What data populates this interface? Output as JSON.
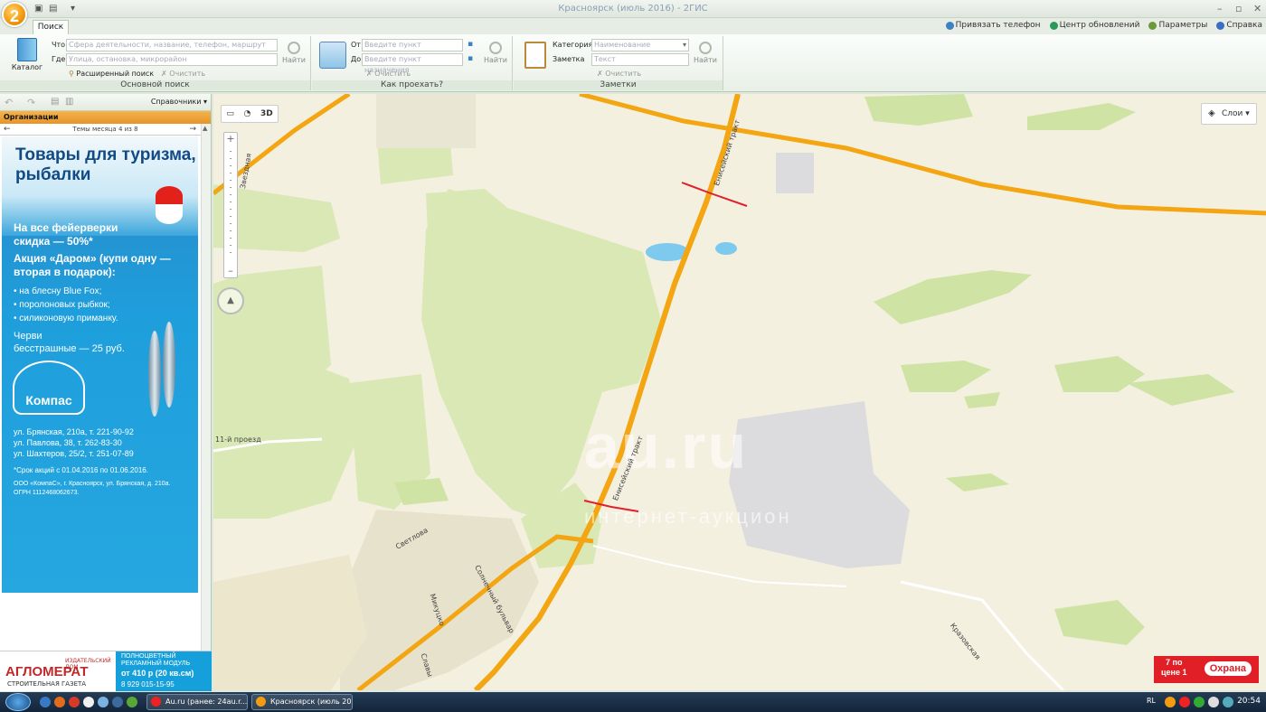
{
  "window": {
    "title": "Красноярск (июль 2016) - 2ГИС",
    "logo_text": "2"
  },
  "ribbon_tabs": [
    {
      "label": "Поиск"
    }
  ],
  "top_links": {
    "phone": "Привязать телефон",
    "updates": "Центр обновлений",
    "params": "Параметры",
    "help": "Справка"
  },
  "basic_search": {
    "catalog_label": "Каталог",
    "what_label": "Что",
    "what_placeholder": "Сфера деятельности, название, телефон, маршрут",
    "where_label": "Где",
    "where_placeholder": "Улица, остановка, микрорайон",
    "advanced": "Расширенный поиск",
    "clear": "Очистить",
    "find": "Найти",
    "caption": "Основной поиск"
  },
  "route": {
    "from_label": "От",
    "from_placeholder": "Введите пункт отправления",
    "to_label": "До",
    "to_placeholder": "Введите пункт назначения",
    "clear": "Очистить",
    "find": "Найти",
    "caption": "Как проехать?"
  },
  "notes": {
    "category_label": "Категория",
    "category_value": "Наименование",
    "note_label": "Заметка",
    "note_placeholder": "Текст",
    "clear": "Очистить",
    "find": "Найти",
    "caption": "Заметки"
  },
  "sidebar": {
    "directories": "Справочники",
    "organizations": "Организации",
    "theme_nav": "Темы месяца 4 из 8"
  },
  "ad": {
    "headline": "Товары для туризма, рыбалки",
    "line1": "На все фейерверки",
    "line2": "скидка — 50%*",
    "line3": "Акция «Даром» (купи одну —",
    "line4": "вторая в подарок):",
    "bullet1": "на блесну Blue Fox;",
    "bullet2": "поролоновых рыбкок;",
    "bullet3": "силиконовую приманку.",
    "worms1": "Черви",
    "worms2": "бесстрашные — 25 руб.",
    "brand": "Компас",
    "addr1": "ул. Брянская, 210а, т. 221-90-92",
    "addr2": "ул. Павлова, 38, т. 262-83-30",
    "addr3": "ул. Шахтеров, 25/2, т. 251-07-89",
    "note": "*Срок акций с 01.04.2016 по 01.06.2016.",
    "legal1": "ООО «КомпаС», г. Красноярск, ул. Брянская, д. 210а.",
    "legal2": "ОГРН 1112468062673."
  },
  "bottom_ad": {
    "publisher": "ИЗДАТЕЛЬСКИЙ ДОМ",
    "brand": "АГЛОМЕРАТ",
    "sub": "СТРОИТЕЛЬНАЯ ГАЗЕТА",
    "r1": "ПОЛНОЦВЕТНЫЙ",
    "r2": "РЕКЛАМНЫЙ МОДУЛЬ",
    "price": "от 410 р (20 кв.см)",
    "phone": "8 929 015-15-95"
  },
  "map": {
    "tool_3d": "3D",
    "layers": "Слои",
    "labels": {
      "zvezdnaya": "Звездная",
      "eniseysky_top": "Енисейский тракт",
      "eniseysky_bottom": "Енисейский тракт",
      "proezd11": "11-й проезд",
      "svetlova": "Светлова",
      "solnechny": "Солнечный бульвар",
      "mikutsko": "Микуцко",
      "slavy": "Славы",
      "krazovskaya": "Кразовская"
    },
    "watermark": "au.ru",
    "watermark2": "интернет-аукцион",
    "okhrana_line1": "7 по",
    "okhrana_line2": "цене 1",
    "okhrana_word": "Охрана"
  },
  "taskbar": {
    "item1": "Au.ru (ранее: 24au.r...",
    "item2": "Красноярск (июль 20...",
    "lang": "RL",
    "clock": "20:54"
  },
  "colors": {
    "orange_road": "#f3a512",
    "forest": "#d9e8b5",
    "water": "#7ec9ee",
    "industrial": "#dcdcde",
    "marker": "#e0202a"
  }
}
